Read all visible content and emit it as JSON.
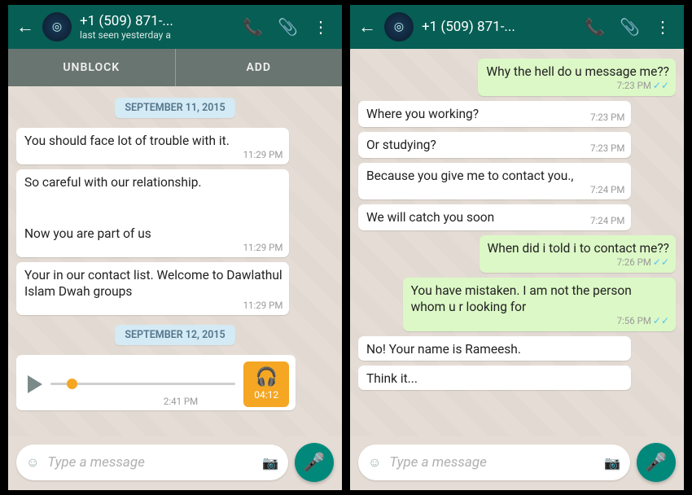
{
  "left": {
    "header": {
      "title": "+1 (509) 871-...",
      "subtitle": "last seen yesterday a"
    },
    "actions": {
      "unblock": "UNBLOCK",
      "add": "ADD"
    },
    "dates": {
      "d1": "SEPTEMBER 11, 2015",
      "d2": "SEPTEMBER 12, 2015"
    },
    "messages": {
      "m1": {
        "text": "You should face lot of trouble with it.",
        "time": "11:29 PM"
      },
      "m2": {
        "text_a": "So careful with our relationship.",
        "text_b": "Now you are part of us",
        "time": "11:29 PM"
      },
      "m3": {
        "text": "Your in our contact list. Welcome to Dawlathul Islam Dwah groups",
        "time": "11:29 PM"
      }
    },
    "voice": {
      "time": "2:41 PM",
      "duration": "04:12"
    },
    "input": {
      "placeholder": "Type a message"
    }
  },
  "right": {
    "header": {
      "title": "+1 (509) 871-..."
    },
    "messages": {
      "m1": {
        "text": "Why the hell do u message me??",
        "time": "7:23 PM",
        "out": true,
        "ticks": true
      },
      "m2": {
        "text": "Where you working?",
        "time": "7:23 PM"
      },
      "m3": {
        "text": "Or studying?",
        "time": "7:23 PM"
      },
      "m4": {
        "text": "Because you give me to contact you.,",
        "time": "7:24 PM"
      },
      "m5": {
        "text": "We will catch you soon",
        "time": "7:24 PM"
      },
      "m6": {
        "text": "When did i told i to contact me??",
        "time": "7:26 PM",
        "out": true,
        "ticks": true
      },
      "m7": {
        "text": "You have mistaken. I am not the person whom u r looking for",
        "time": "7:56 PM",
        "out": true,
        "ticks": true
      },
      "m8": {
        "text": "No! Your name is Rameesh.",
        "time": ""
      },
      "m9": {
        "text": "Think it...",
        "time": ""
      }
    },
    "input": {
      "placeholder": "Type a message"
    }
  }
}
